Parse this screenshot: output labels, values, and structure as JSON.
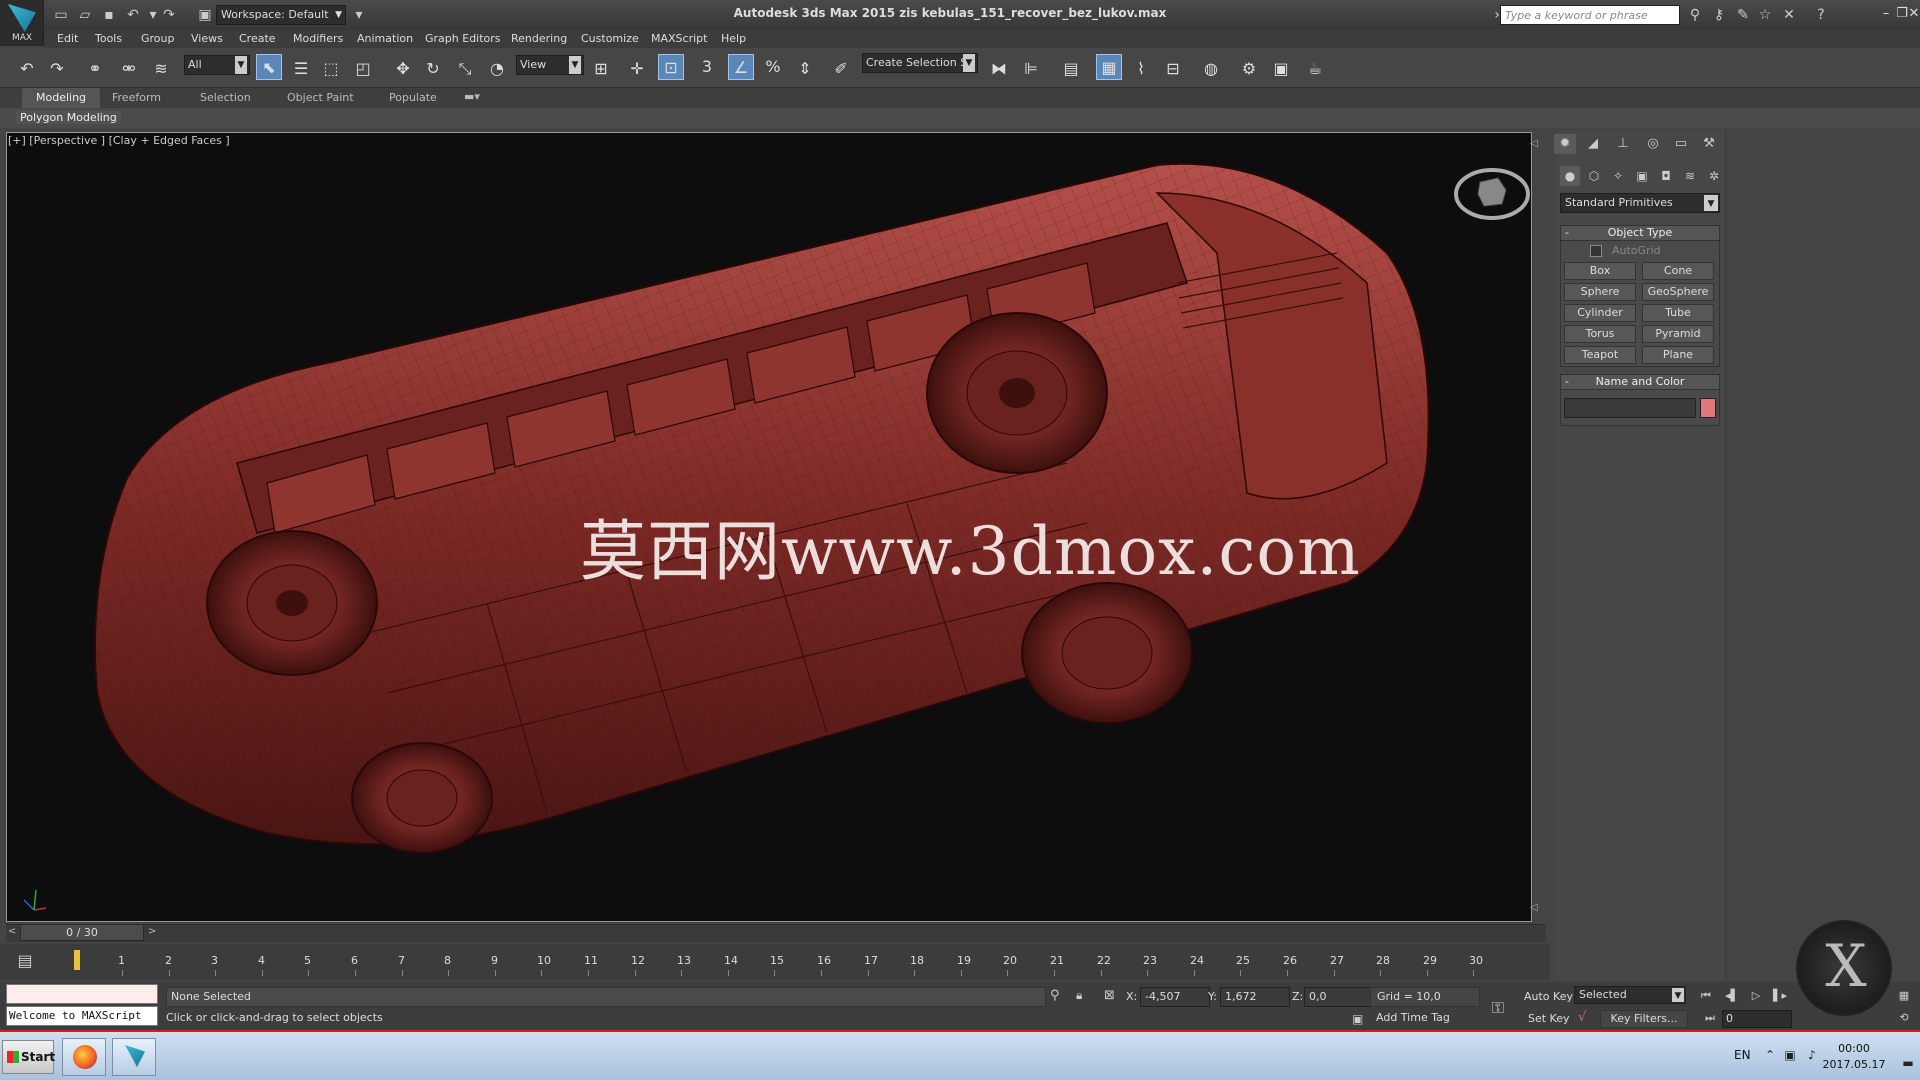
{
  "app": {
    "logo_text": "MAX",
    "workspace": "Workspace: Default",
    "window_title": "Autodesk 3ds Max  2015     zis kebulas_151_recover_bez_lukov.max",
    "search_placeholder": "Type a keyword or phrase"
  },
  "menu": [
    "Edit",
    "Tools",
    "Group",
    "Views",
    "Create",
    "Modifiers",
    "Animation",
    "Graph Editors",
    "Rendering",
    "Customize",
    "MAXScript",
    "Help"
  ],
  "toolbar": {
    "selection_filter": "All",
    "reference_coord": "View",
    "named_selection": "Create Selection Se",
    "snap_3": "3",
    "percent_snap": "%"
  },
  "ribbon": {
    "tabs": [
      "Modeling",
      "Freeform",
      "Selection",
      "Object Paint",
      "Populate"
    ],
    "panel_label": "Polygon Modeling"
  },
  "viewport": {
    "label": "[+] [Perspective ] [Clay + Edged Faces ]",
    "watermark": "莫西网www.3dmox.com",
    "model_color": "#8a2f2a"
  },
  "command_panel": {
    "category": "Standard Primitives",
    "object_type_title": "Object Type",
    "autogrid_label": "AutoGrid",
    "primitives": [
      "Box",
      "Cone",
      "Sphere",
      "GeoSphere",
      "Cylinder",
      "Tube",
      "Torus",
      "Pyramid",
      "Teapot",
      "Plane"
    ],
    "name_color_title": "Name and Color",
    "object_color": "#e07a7a"
  },
  "timeline": {
    "position_label": "0 / 30",
    "ticks": [
      "1",
      "2",
      "3",
      "4",
      "5",
      "6",
      "7",
      "8",
      "9",
      "10",
      "11",
      "12",
      "13",
      "14",
      "15",
      "16",
      "17",
      "18",
      "19",
      "20",
      "21",
      "22",
      "23",
      "24",
      "25",
      "26",
      "27",
      "28",
      "29",
      "30"
    ]
  },
  "status": {
    "maxscript_output": "Welcome to MAXScript",
    "selection": "None Selected",
    "prompt": "Click or click-and-drag to select objects",
    "x_label": "X:",
    "x_value": "-4,507",
    "y_label": "Y:",
    "y_value": "1,672",
    "z_label": "Z:",
    "z_value": "0,0",
    "grid": "Grid = 10,0",
    "add_time_tag": "Add Time Tag",
    "auto_key": "Auto Key",
    "set_key": "Set Key",
    "selected_option": "Selected",
    "key_filters": "Key Filters...",
    "current_frame": "0"
  },
  "taskbar": {
    "start_label": "Start",
    "language": "EN",
    "time": "00:00",
    "date": "2017.05.17",
    "accent_color": "#d81c1c"
  }
}
